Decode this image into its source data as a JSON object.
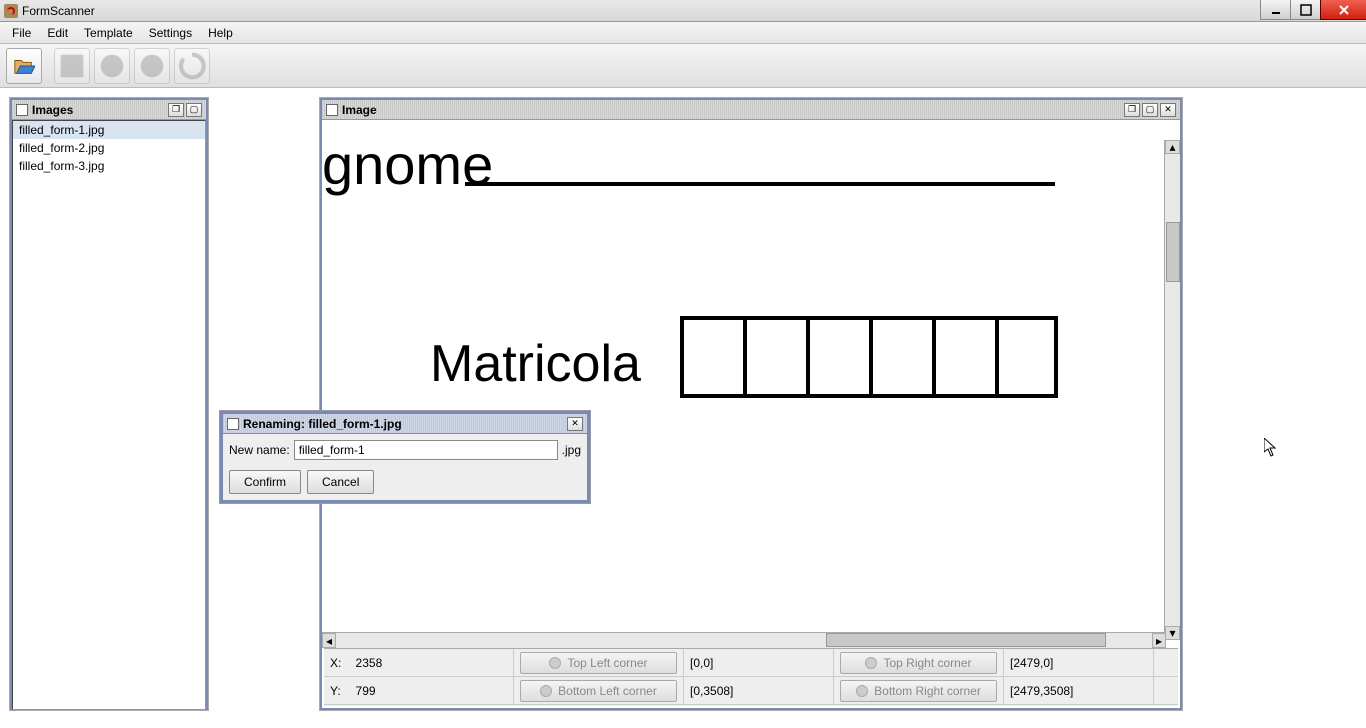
{
  "window": {
    "title": "FormScanner"
  },
  "menus": {
    "file": "File",
    "edit": "Edit",
    "template": "Template",
    "settings": "Settings",
    "help": "Help"
  },
  "frames": {
    "images": {
      "title": "Images",
      "items": [
        "filled_form-1.jpg",
        "filled_form-2.jpg",
        "filled_form-3.jpg"
      ]
    },
    "image": {
      "title": "Image"
    }
  },
  "form_content": {
    "text1": "gnome",
    "text2": "Matricola"
  },
  "status": {
    "x_label": "X:",
    "x_value": "2358",
    "y_label": "Y:",
    "y_value": "799",
    "tl_btn": "Top Left corner",
    "tl_val": "[0,0]",
    "tr_btn": "Top Right corner",
    "tr_val": "[2479,0]",
    "bl_btn": "Bottom Left corner",
    "bl_val": "[0,3508]",
    "br_btn": "Bottom Right corner",
    "br_val": "[2479,3508]"
  },
  "rename": {
    "title": "Renaming: filled_form-1.jpg",
    "label": "New name:",
    "value": "filled_form-1",
    "ext": ".jpg",
    "confirm": "Confirm",
    "cancel": "Cancel"
  }
}
